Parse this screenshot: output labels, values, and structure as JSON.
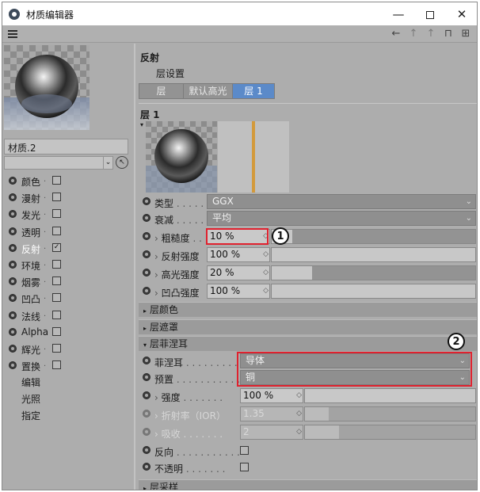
{
  "window": {
    "title": "材质编辑器",
    "controls": {
      "minimize": "—",
      "maximize": "",
      "close": "✕"
    }
  },
  "toolbar": {
    "nav_back": "←",
    "nav_up": "↑",
    "nav_up2": "↑",
    "lock": "🔒",
    "new": "⊞"
  },
  "left": {
    "material_name": "材质.2",
    "channels": [
      {
        "label": "颜色",
        "checked": false
      },
      {
        "label": "漫射",
        "checked": false
      },
      {
        "label": "发光",
        "checked": false
      },
      {
        "label": "透明",
        "checked": false
      },
      {
        "label": "反射",
        "checked": true
      },
      {
        "label": "环境",
        "checked": false
      },
      {
        "label": "烟雾",
        "checked": false
      },
      {
        "label": "凹凸",
        "checked": false
      },
      {
        "label": "法线",
        "checked": false
      },
      {
        "label": "Alpha",
        "checked": false
      },
      {
        "label": "辉光",
        "checked": false
      },
      {
        "label": "置换",
        "checked": false
      }
    ],
    "extra": [
      "编辑",
      "光照",
      "指定"
    ]
  },
  "right": {
    "section_title": "反射",
    "layer_settings": "层设置",
    "tabs": [
      "层",
      "默认高光",
      "层 1"
    ],
    "layer_title": "层 1",
    "type_label": "类型",
    "type_value": "GGX",
    "falloff_label": "衰减",
    "falloff_value": "平均",
    "roughness_label": "粗糙度",
    "roughness_value": "10 %",
    "reflect_label": "反射强度",
    "reflect_value": "100 %",
    "specular_label": "高光强度",
    "specular_value": "20 %",
    "bump_label": "凹凸强度",
    "bump_value": "100 %",
    "sec_color": "层颜色",
    "sec_mask": "层遮罩",
    "sec_fresnel": "层菲涅耳",
    "fresnel_label": "菲涅耳",
    "fresnel_value": "导体",
    "preset_label": "预置",
    "preset_value": "铜",
    "strength_label": "强度",
    "strength_value": "100 %",
    "ior_label": "折射率（IOR）",
    "ior_value": "1.35",
    "absorb_label": "吸收",
    "absorb_value": "2",
    "invert_label": "反向",
    "opaque_label": "不透明",
    "sec_sampling": "层采样",
    "callout_1": "1",
    "callout_2": "2"
  },
  "levels": {
    "roughness": 0.1,
    "reflect": 1.0,
    "specular": 0.2,
    "bump": 1.0,
    "strength": 1.0,
    "ior_fill": 0.14,
    "absorb_fill": 0.2
  },
  "colors": {
    "accent": "#5b8ac9",
    "highlight_box": "#e0212e",
    "panel": "#adadad"
  }
}
